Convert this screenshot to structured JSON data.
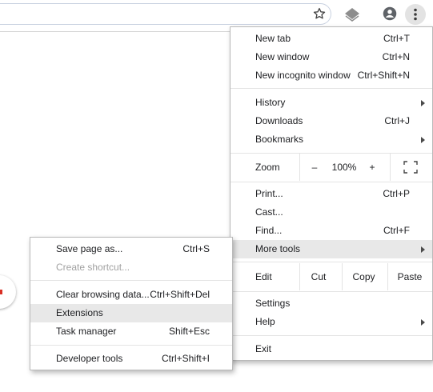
{
  "main_menu": {
    "new_tab": {
      "label": "New tab",
      "shortcut": "Ctrl+T"
    },
    "new_window": {
      "label": "New window",
      "shortcut": "Ctrl+N"
    },
    "new_incognito": {
      "label": "New incognito window",
      "shortcut": "Ctrl+Shift+N"
    },
    "history": {
      "label": "History"
    },
    "downloads": {
      "label": "Downloads",
      "shortcut": "Ctrl+J"
    },
    "bookmarks": {
      "label": "Bookmarks"
    },
    "zoom": {
      "label": "Zoom",
      "minus": "–",
      "level": "100%",
      "plus": "+"
    },
    "print": {
      "label": "Print...",
      "shortcut": "Ctrl+P"
    },
    "cast": {
      "label": "Cast..."
    },
    "find": {
      "label": "Find...",
      "shortcut": "Ctrl+F"
    },
    "more_tools": {
      "label": "More tools"
    },
    "edit": {
      "label": "Edit",
      "cut": "Cut",
      "copy": "Copy",
      "paste": "Paste"
    },
    "settings": {
      "label": "Settings"
    },
    "help": {
      "label": "Help"
    },
    "exit": {
      "label": "Exit"
    }
  },
  "sub_menu": {
    "save_page": {
      "label": "Save page as...",
      "shortcut": "Ctrl+S"
    },
    "create_shortcut": {
      "label": "Create shortcut..."
    },
    "clear_browsing": {
      "label": "Clear browsing data...",
      "shortcut": "Ctrl+Shift+Del"
    },
    "extensions": {
      "label": "Extensions"
    },
    "task_manager": {
      "label": "Task manager",
      "shortcut": "Shift+Esc"
    },
    "developer_tools": {
      "label": "Developer tools",
      "shortcut": "Ctrl+Shift+I"
    }
  },
  "icons": {
    "bookmark_star": "star-icon",
    "extension": "extension-layers-icon",
    "profile": "account-circle-icon",
    "menu": "more-vert-icon",
    "fullscreen": "fullscreen-icon",
    "submenu_arrow": "chevron-right-icon"
  },
  "colors": {
    "highlight": "#e8e8e8",
    "menu_border": "#b9b9b9",
    "disabled_text": "#a1a1a1",
    "profile_icon": "#5f6368"
  }
}
